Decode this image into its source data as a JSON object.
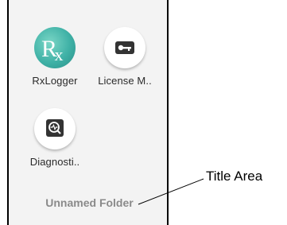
{
  "folder": {
    "name": "Unnamed Folder",
    "apps": [
      {
        "label": "RxLogger",
        "icon": "rxlogger-icon"
      },
      {
        "label": "License M..",
        "icon": "key-icon"
      },
      {
        "label": "Diagnosti..",
        "icon": "diagnostic-magnifier-icon"
      }
    ]
  },
  "callout": {
    "text": "Title Area"
  },
  "colors": {
    "panel_background": "#f3f3f3",
    "rx_icon_teal": "#3fb1a6",
    "icon_dark": "#333333",
    "folder_name_gray": "#8a8a8a"
  }
}
